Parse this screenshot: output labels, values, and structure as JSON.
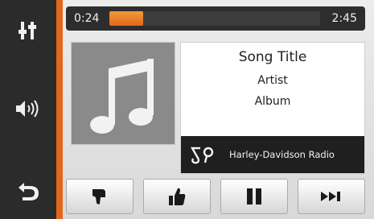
{
  "player": {
    "elapsed": "0:24",
    "total": "2:45",
    "progress_fraction": 0.16
  },
  "track": {
    "title": "Song Title",
    "artist": "Artist",
    "album": "Album"
  },
  "source": {
    "label": "Harley-Davidson Radio",
    "icon": "radio-logo-icon"
  },
  "rail": {
    "icons": [
      "equalizer-icon",
      "volume-icon",
      "back-icon"
    ]
  },
  "controls": {
    "icons": [
      "thumbs-down-icon",
      "thumbs-up-icon",
      "pause-icon",
      "skip-next-icon"
    ]
  },
  "colors": {
    "accent": "#e2661b",
    "progress_fill": "#f08a2a",
    "rail": "#2b2b2b",
    "art_bg": "#8a8a8a"
  }
}
